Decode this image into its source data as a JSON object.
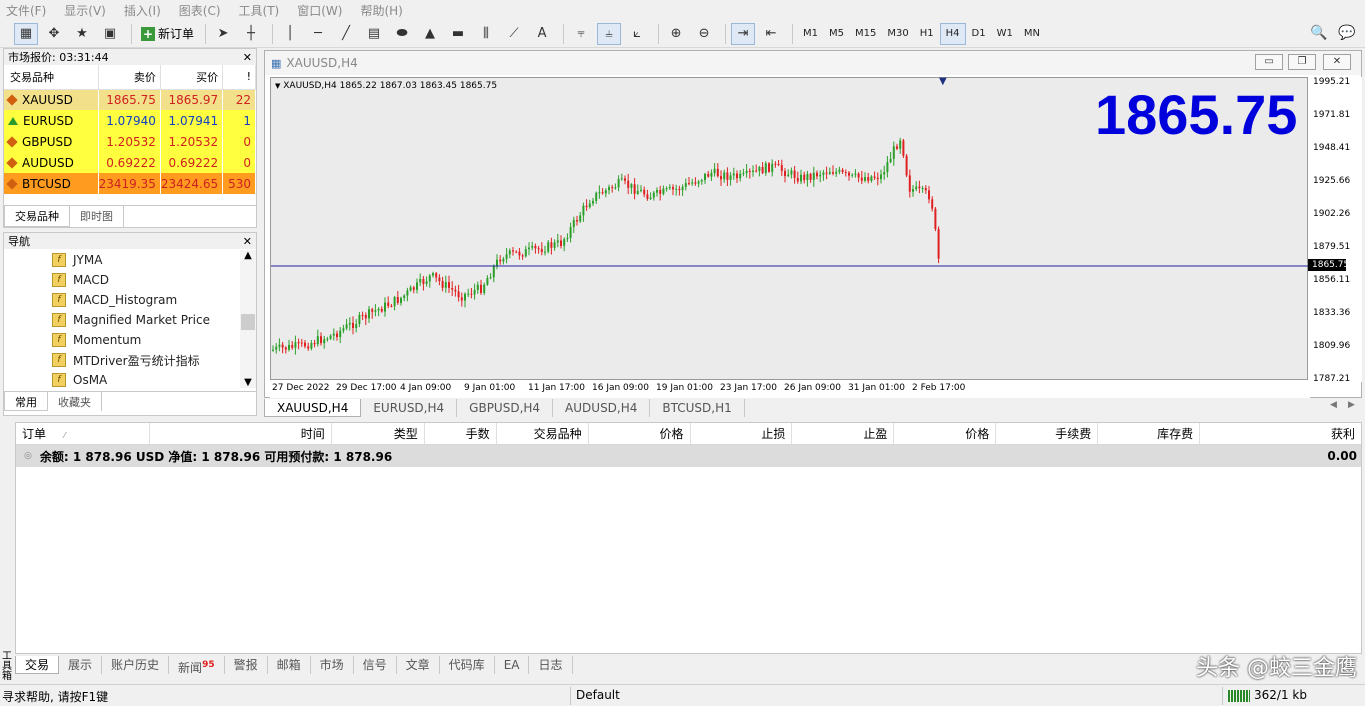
{
  "menu": [
    "文件(F)",
    "显示(V)",
    "插入(I)",
    "图表(C)",
    "工具(T)",
    "窗口(W)",
    "帮助(H)"
  ],
  "toolbar": {
    "new_order_label": "新订单",
    "timeframes": [
      "M1",
      "M5",
      "M15",
      "M30",
      "H1",
      "H4",
      "D1",
      "W1",
      "MN"
    ],
    "active_timeframe": "H4"
  },
  "market_watch": {
    "title": "市场报价: 03:31:44",
    "columns": [
      "交易品种",
      "卖价",
      "买价",
      "!"
    ],
    "rows": [
      {
        "symbol": "XAUUSD",
        "bid": "1865.75",
        "ask": "1865.97",
        "spread": "22",
        "bg": "#f3e08a",
        "dir": "diamond",
        "color": "#d02020"
      },
      {
        "symbol": "EURUSD",
        "bid": "1.07940",
        "ask": "1.07941",
        "spread": "1",
        "bg": "#ffff40",
        "dir": "up",
        "color": "#1040c0"
      },
      {
        "symbol": "GBPUSD",
        "bid": "1.20532",
        "ask": "1.20532",
        "spread": "0",
        "bg": "#ffff40",
        "dir": "diamond",
        "color": "#d02020"
      },
      {
        "symbol": "AUDUSD",
        "bid": "0.69222",
        "ask": "0.69222",
        "spread": "0",
        "bg": "#ffff40",
        "dir": "diamond",
        "color": "#d02020"
      },
      {
        "symbol": "BTCUSD",
        "bid": "23419.35",
        "ask": "23424.65",
        "spread": "530",
        "bg": "#ff9c20",
        "dir": "diamond",
        "color": "#d02020"
      }
    ],
    "tabs": [
      "交易品种",
      "即时图"
    ]
  },
  "navigator": {
    "title": "导航",
    "items": [
      "JYMA",
      "MACD",
      "MACD_Histogram",
      "Magnified Market Price",
      "Momentum",
      "MTDriver盈亏统计指标",
      "OsMA"
    ],
    "tabs": [
      "常用",
      "收藏夹"
    ]
  },
  "chart": {
    "window_title": "XAUUSD,H4",
    "info_line": "XAUUSD,H4  1865.22 1867.03 1863.45 1865.75",
    "big_price": "1865.75",
    "price_labels": [
      "1995.21",
      "1971.81",
      "1948.41",
      "1925.66",
      "1902.26",
      "1879.51",
      "1856.11",
      "1833.36",
      "1809.96",
      "1787.21"
    ],
    "current_price_label": "1865.75",
    "time_labels": [
      "27 Dec 2022",
      "29 Dec 17:00",
      "4 Jan 09:00",
      "9 Jan 01:00",
      "11 Jan 17:00",
      "16 Jan 09:00",
      "19 Jan 01:00",
      "23 Jan 17:00",
      "26 Jan 09:00",
      "31 Jan 01:00",
      "2 Feb 17:00"
    ],
    "tabs": [
      "XAUUSD,H4",
      "EURUSD,H4",
      "GBPUSD,H4",
      "AUDUSD,H4",
      "BTCUSD,H1"
    ],
    "up_color": "#2aa02a",
    "down_color": "#e02020",
    "bid_line_color": "#2020a0"
  },
  "terminal": {
    "columns": [
      "订单",
      "时间",
      "类型",
      "手数",
      "交易品种",
      "价格",
      "止损",
      "止盈",
      "价格",
      "手续费",
      "库存费",
      "获利"
    ],
    "balance_line": "余额: 1 878.96 USD  净值: 1 878.96  可用预付款: 1 878.96",
    "profit": "0.00",
    "tabs": [
      "交易",
      "展示",
      "账户历史",
      "新闻",
      "警报",
      "邮箱",
      "市场",
      "信号",
      "文章",
      "代码库",
      "EA",
      "日志"
    ],
    "news_badge": "95",
    "side_label": "工具箱"
  },
  "status": {
    "help": "寻求帮助, 请按F1键",
    "profile": "Default",
    "traffic": "362/1 kb"
  },
  "watermark": "头条 @蛟三金鹰"
}
